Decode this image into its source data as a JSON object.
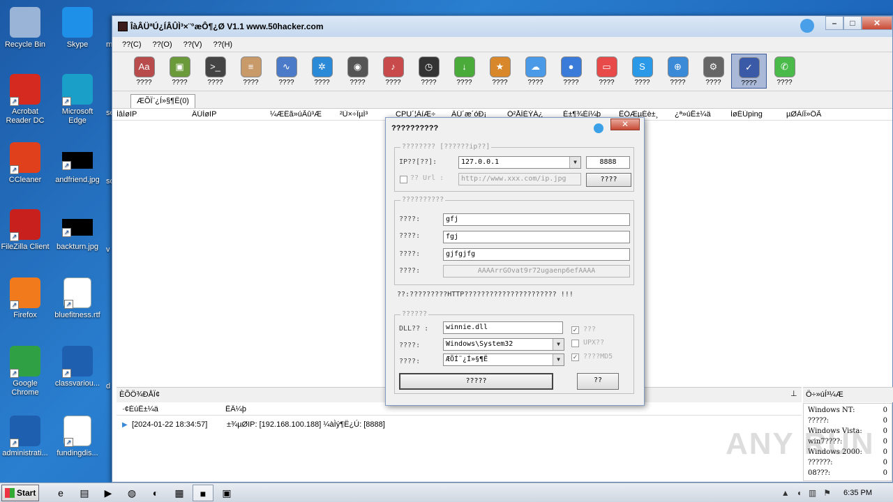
{
  "desktop": {
    "icons": [
      {
        "label": "Recycle Bin",
        "icon": "recycle-bin-icon",
        "color": "#9ab4d8"
      },
      {
        "label": "Skype",
        "icon": "skype-icon",
        "color": "#1e90e8"
      },
      {
        "label": "Acrobat Reader DC",
        "icon": "acrobat-icon",
        "color": "#d42a1f"
      },
      {
        "label": "Microsoft Edge",
        "icon": "edge-icon",
        "color": "#1aa0c8"
      },
      {
        "label": "CCleaner",
        "icon": "ccleaner-icon",
        "color": "#e0401c"
      },
      {
        "label": "andfriend.jpg",
        "icon": "image-file-icon",
        "color": "#000000"
      },
      {
        "label": "FileZilla Client",
        "icon": "filezilla-icon",
        "color": "#c8201c"
      },
      {
        "label": "backturn.jpg",
        "icon": "image-file-icon",
        "color": "#000000"
      },
      {
        "label": "Firefox",
        "icon": "firefox-icon",
        "color": "#f07a1c"
      },
      {
        "label": "bluefitness.rtf",
        "icon": "word-doc-icon",
        "color": "#ffffff"
      },
      {
        "label": "Google Chrome",
        "icon": "chrome-icon",
        "color": "#2fa043"
      },
      {
        "label": "classvariou...",
        "icon": "blank-file-icon",
        "color": "#1f5fb0"
      },
      {
        "label": "administrati...",
        "icon": "blank-file-icon",
        "color": "#1f5fb0"
      },
      {
        "label": "fundingdis...",
        "icon": "word-doc-icon",
        "color": "#ffffff"
      }
    ],
    "partial_labels": [
      "m",
      "ser",
      "so",
      "v",
      "d"
    ]
  },
  "window": {
    "title": "ÎàÂÜªÚ¿ÍÂÛÌ³×¨°æÔ¶¿Ø V1.1 www.50hacker.com",
    "menu": [
      "??(C)",
      "??(O)",
      "??(V)",
      "??(H)"
    ],
    "toolbar": [
      {
        "label": "????",
        "icon": "font-icon",
        "glyph": "Aa",
        "color": "#b84c4c"
      },
      {
        "label": "????",
        "icon": "monitor-icon",
        "glyph": "▣",
        "color": "#6a9a3a"
      },
      {
        "label": "????",
        "icon": "terminal-icon",
        "glyph": ">_",
        "color": "#444444"
      },
      {
        "label": "????",
        "icon": "registry-icon",
        "glyph": "≡",
        "color": "#c89a6a"
      },
      {
        "label": "????",
        "icon": "chart-icon",
        "glyph": "∿",
        "color": "#4a7ac8"
      },
      {
        "label": "????",
        "icon": "process-icon",
        "glyph": "✲",
        "color": "#2a8ad8"
      },
      {
        "label": "????",
        "icon": "webcam-icon",
        "glyph": "◉",
        "color": "#555555"
      },
      {
        "label": "????",
        "icon": "microphone-icon",
        "glyph": "♪",
        "color": "#c84a4a"
      },
      {
        "label": "????",
        "icon": "clock-icon",
        "glyph": "◷",
        "color": "#333333"
      },
      {
        "label": "????",
        "icon": "download-icon",
        "glyph": "↓",
        "color": "#4aaa3a"
      },
      {
        "label": "????",
        "icon": "star-icon",
        "glyph": "★",
        "color": "#d8882a"
      },
      {
        "label": "????",
        "icon": "cloud-icon",
        "glyph": "☁",
        "color": "#4a9ae8"
      },
      {
        "label": "????",
        "icon": "chat-icon",
        "glyph": "●",
        "color": "#3a7ad8"
      },
      {
        "label": "????",
        "icon": "calendar-icon",
        "glyph": "▭",
        "color": "#e84a4a"
      },
      {
        "label": "????",
        "icon": "skype-icon",
        "glyph": "S",
        "color": "#2a9ae8"
      },
      {
        "label": "????",
        "icon": "globe-icon",
        "glyph": "⊕",
        "color": "#3a8ad8"
      },
      {
        "label": "????",
        "icon": "gear-icon",
        "glyph": "⚙",
        "color": "#666666"
      },
      {
        "label": "????",
        "icon": "checklist-icon",
        "glyph": "✓",
        "color": "#3a5aa8",
        "active": true
      },
      {
        "label": "????",
        "icon": "phone-icon",
        "glyph": "✆",
        "color": "#4aba4a"
      }
    ],
    "tab_label": "ÆÕÏ¨¿Í»§¶Ë(0)",
    "columns": [
      "ÍâÍøIP",
      "ÄÚÍøIP",
      "¼ÆËã»úÃû³Æ",
      "²Ù×÷ÏµÍ³",
      "CPU´¦ÀíÆ÷",
      "ÄÚ´æ´óÐ¡",
      "Ó²ÅÌÈÝÁ¿",
      "É±¶¾Èí¼þ",
      "ÊÓÆµÉè±¸",
      "¿ª»úÊ±¼ä",
      "ÍøÈÙping",
      "µØÀíÎ»ÖÃ"
    ],
    "log_panel_title": "ÈÕÖ¾ÐÅÏ¢",
    "log_columns": [
      "·¢ÉúÊ±¼ä",
      "ÊÂ¼þ"
    ],
    "log_rows": [
      {
        "time": "[2024-01-22 18:34:57]",
        "event": "±¾µØIP: [192.168.100.188] ¼àÌý¶Ë¿Ú: [8888]"
      }
    ],
    "stat_panel_title": "Ö÷»úÍ³¼Æ",
    "stats": [
      {
        "label": "Windows NT:",
        "value": "0"
      },
      {
        "label": "?????:",
        "value": "0"
      },
      {
        "label": "Windows Vista:",
        "value": "0"
      },
      {
        "label": "win7????:",
        "value": "0"
      },
      {
        "label": "Windows 2000:",
        "value": "0"
      },
      {
        "label": "??????:",
        "value": "0"
      },
      {
        "label": "08???:",
        "value": "0"
      }
    ]
  },
  "dialog": {
    "title": "??????????",
    "group1_label": "???????? [??????ip??]",
    "ip_label": "IP??[??]:",
    "ip_value": "127.0.0.1",
    "port_value": "8888",
    "url_label": "?? Url :",
    "url_value": "http://www.xxx.com/ip.jpg",
    "url_button": "????",
    "group2_label": "??????????",
    "fields": [
      {
        "label": "????:",
        "value": "gfj"
      },
      {
        "label": "????:",
        "value": "fgj"
      },
      {
        "label": "????:",
        "value": "gjfgjfg"
      },
      {
        "label": "????:",
        "value": "AAAArrGOvat9r72ugaenp6efAAAA"
      }
    ],
    "note": "??:?????????HTTP?????????????????????? !!!",
    "group3_label": "??????",
    "dll_label": "DLL?? :",
    "dll_value": "winnie.dll",
    "path_label": "????:",
    "path_value": "Windows\\System32",
    "group_name_label": "????:",
    "group_name_value": "ÆÕÍ¨¿Í»§¶Ë",
    "chk1_label": "???",
    "chk2_label": "UPX??",
    "chk3_label": "????MD5",
    "generate_button": "?????",
    "exit_button": "??"
  },
  "taskbar": {
    "start_label": "Start",
    "apps": [
      {
        "icon": "ie-icon",
        "glyph": "e"
      },
      {
        "icon": "explorer-icon",
        "glyph": "▤"
      },
      {
        "icon": "media-player-icon",
        "glyph": "▶"
      },
      {
        "icon": "chrome-icon",
        "glyph": "◍"
      },
      {
        "icon": "edge-icon",
        "glyph": "◐"
      },
      {
        "icon": "winrar-icon",
        "glyph": "▦"
      },
      {
        "icon": "remote-control-app-icon",
        "glyph": "■",
        "open": true
      },
      {
        "icon": "console-app-icon",
        "glyph": "▣"
      }
    ],
    "clock": "6:35 PM"
  },
  "watermark": "ANY RUN"
}
